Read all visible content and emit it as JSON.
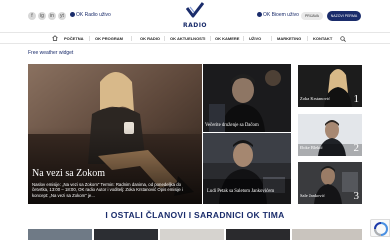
{
  "header": {
    "socials": [
      "f",
      "ig",
      "in",
      "yt"
    ],
    "live_left": "OK Radio uživo",
    "live_right": "OK Bioem uživo",
    "logo_text": "RADIO",
    "login_label": "PRIJAVA",
    "call_label": "NAZOVI PERMA"
  },
  "nav": {
    "items": [
      "POČETNA",
      "OK PROGRAM",
      "OK RADIO",
      "OK AKTUELNOSTI",
      "OK KAMERE",
      "UŽIVO",
      "MARKETING",
      "KONTAKT"
    ]
  },
  "weather_label": "Free weather widget",
  "hero": {
    "title": "Na vezi sa Zokom",
    "description": "Naslov emisije: „Na vezi sa Zokom\" Termin: Radnim danima, od ponedeljka do četvrtka, 13:00 – 18:00, OK radio Autor i voditelj: Zoka Krstanović Opis emisije i koncept: „Na vezi sa Zokom\" je..."
  },
  "cards": [
    {
      "caption": "Večerite druženje sa Dačom"
    },
    {
      "caption": "Ludi Petak sa Saletom Jankovićem"
    }
  ],
  "sidebar": [
    {
      "name": "Zoka Krstanović",
      "number": "1"
    },
    {
      "name": "Đoke Blekić",
      "number": "2"
    },
    {
      "name": "Sale Janković",
      "number": "3"
    }
  ],
  "section_title": "I OSTALI ČLANOVI I SARADNICI OK TIMA",
  "colors": {
    "brand": "#1a2c6b",
    "background": "#ffffff"
  }
}
